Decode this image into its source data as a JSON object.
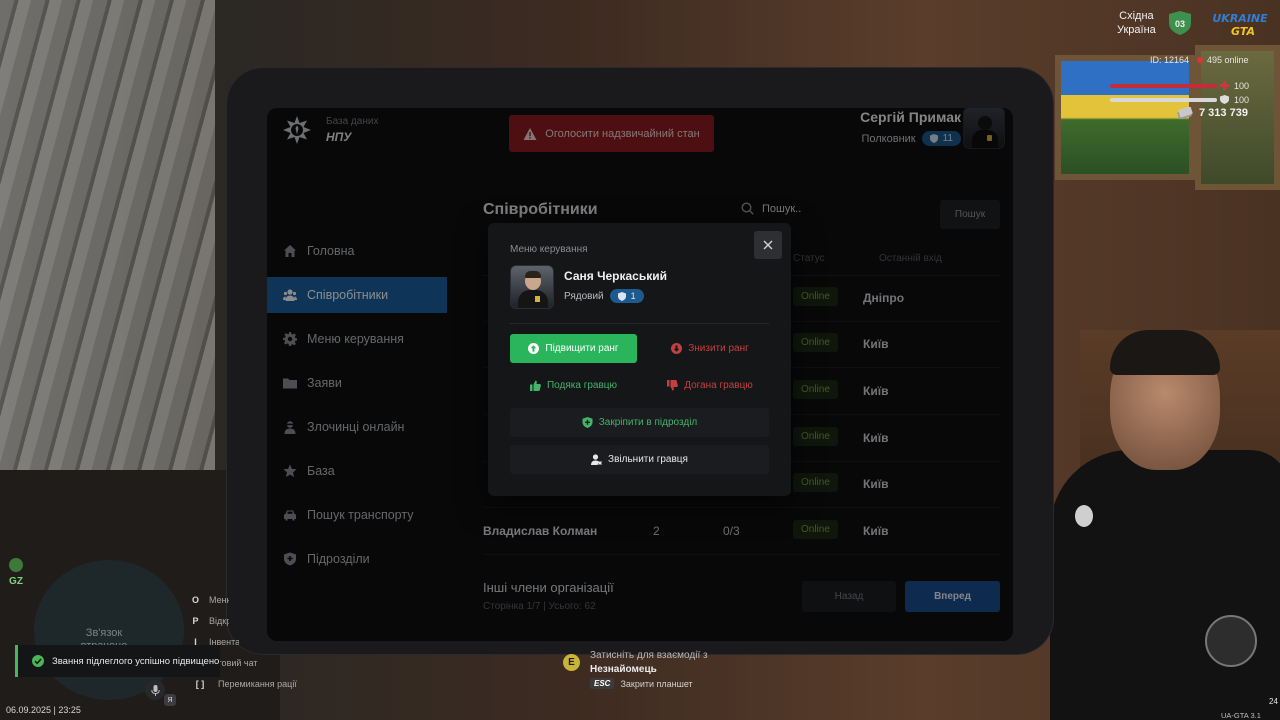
{
  "brand": {
    "subtitle": "База даних",
    "title": "НПУ"
  },
  "alert_button": "Оголосити надзвичайний стан",
  "user": {
    "name": "Сергій Примак",
    "rank": "Полковник",
    "rank_level": "11"
  },
  "sidebar": {
    "items": [
      {
        "label": "Головна",
        "icon": "home-icon"
      },
      {
        "label": "Співробітники",
        "icon": "users-icon",
        "active": true
      },
      {
        "label": "Меню керування",
        "icon": "gear-icon"
      },
      {
        "label": "Заяви",
        "icon": "folder-icon"
      },
      {
        "label": "Злочинці онлайн",
        "icon": "criminal-icon"
      },
      {
        "label": "База",
        "icon": "star-icon"
      },
      {
        "label": "Пошук транспорту",
        "icon": "car-icon"
      },
      {
        "label": "Підрозділи",
        "icon": "shield-icon"
      }
    ]
  },
  "main": {
    "title": "Співробітники",
    "search_placeholder": "Пошук..",
    "search_button": "Пошук",
    "columns": {
      "status": "Статус",
      "last_login": "Останній вхід"
    },
    "rows": [
      {
        "name": "",
        "a": "",
        "b": "",
        "status": "Online",
        "city": "Дніпро"
      },
      {
        "name": "",
        "a": "",
        "b": "",
        "status": "Online",
        "city": "Київ"
      },
      {
        "name": "",
        "a": "",
        "b": "",
        "status": "Online",
        "city": "Київ"
      },
      {
        "name": "",
        "a": "",
        "b": "",
        "status": "Online",
        "city": "Київ"
      },
      {
        "name": "",
        "a": "",
        "b": "",
        "status": "Online",
        "city": "Київ"
      },
      {
        "name": "Владислав Колман",
        "a": "2",
        "b": "0/3",
        "status": "Online",
        "city": "Київ"
      }
    ],
    "footer_title": "Інші члени організації",
    "footer_sub": "Сторінка 1/7 | Усього: 62",
    "back_button": "Назад",
    "next_button": "Вперед"
  },
  "modal": {
    "title": "Меню керування",
    "member_name": "Саня Черкаський",
    "member_rank": "Рядовий",
    "member_rank_level": "1",
    "promote": "Підвищити ранг",
    "demote": "Знизити ранг",
    "thanks": "Подяка гравцю",
    "reprimand": "Догана гравцю",
    "assign": "Закріпити в підрозділ",
    "fire": "Звільнити гравця"
  },
  "hud": {
    "region_line1": "Східна",
    "region_line2": "Україна",
    "region_badge": "03",
    "id": "ID: 12164",
    "online": "495 online",
    "health": "100",
    "armor": "100",
    "money": "7 313 739",
    "gz": "GZ",
    "minimap_line1": "Зв'язок",
    "minimap_line2": "втрачено",
    "keys": [
      {
        "key": "O",
        "label": "Меню"
      },
      {
        "key": "P",
        "label": "Відкрити"
      },
      {
        "key": "I",
        "label": "Інвентар"
      },
      {
        "key": "",
        "label": "кстовий чат"
      },
      {
        "key": "[ ]",
        "label": "Перемикання рації"
      }
    ],
    "toast": "Звання підлеглого успішно підвищено",
    "mic_key": "Я",
    "datetime": "06.09.2025 | 23:25",
    "interact_line1": "Затисніть для взаємодії з",
    "interact_line2": "Незнайомець",
    "interact_key": "E",
    "esc_key": "ESC",
    "esc_label": "Закрити планшет",
    "version": "UA-GTA 3.1",
    "fps": "24"
  },
  "colors": {
    "accent": "#1b5fa0",
    "danger": "#8d1c1f",
    "success": "#2ab45c",
    "online": "#7aa343"
  }
}
